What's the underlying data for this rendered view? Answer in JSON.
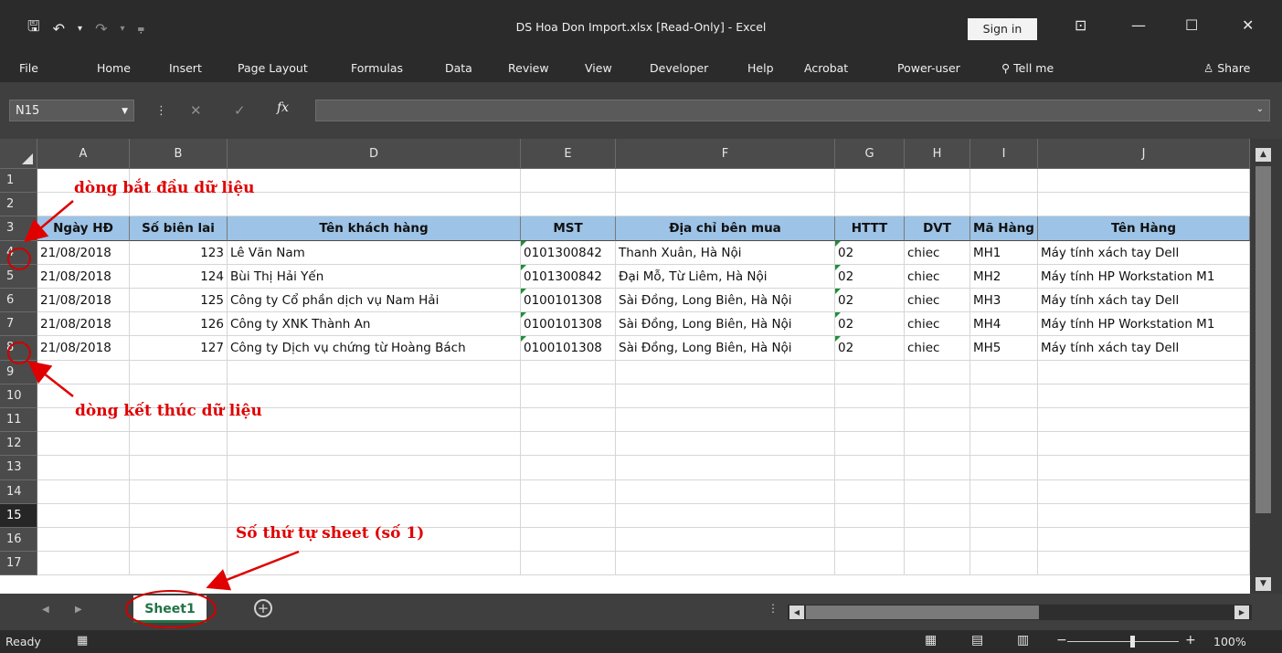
{
  "window": {
    "title": "DS Hoa Don Import.xlsx  [Read-Only]  -  Excel",
    "sign_in": "Sign in",
    "qat": {
      "save": "🖫",
      "undo": "↶",
      "undo_dd": "▾",
      "redo": "↷",
      "redo_dd": "▾",
      "customize": "⩦"
    },
    "controls": {
      "ribbon_display": "⊡",
      "minimize": "—",
      "maximize": "☐",
      "close": "✕"
    }
  },
  "menu": [
    "File",
    "Home",
    "Insert",
    "Page Layout",
    "Formulas",
    "Data",
    "Review",
    "View",
    "Developer",
    "Help",
    "Acrobat",
    "Power-user"
  ],
  "tell_me": "Tell me",
  "share": "Share",
  "formula_bar": {
    "name_box": "N15",
    "cancel": "✕",
    "enter": "✓",
    "fx": "fx",
    "value": ""
  },
  "columns": [
    "A",
    "B",
    "D",
    "E",
    "F",
    "G",
    "H",
    "I",
    "J"
  ],
  "row_numbers": [
    "1",
    "2",
    "3",
    "4",
    "5",
    "6",
    "7",
    "8",
    "9",
    "10",
    "11",
    "12",
    "13",
    "14",
    "15",
    "16",
    "17"
  ],
  "active_row": "15",
  "table": {
    "headers": [
      "Ngày HĐ",
      "Số biên lai",
      "Tên khách hàng",
      "MST",
      "Địa chỉ bên mua",
      "HTTT",
      "DVT",
      "Mã Hàng",
      "Tên Hàng"
    ],
    "rows": [
      [
        "21/08/2018",
        "123",
        "Lê Văn Nam",
        "0101300842",
        "Thanh Xuân, Hà Nội",
        "02",
        "chiec",
        "MH1",
        "Máy tính xách tay Dell"
      ],
      [
        "21/08/2018",
        "124",
        "Bùi Thị Hải Yến",
        "0101300842",
        "Đại Mỗ, Từ Liêm, Hà Nội",
        "02",
        "chiec",
        "MH2",
        "Máy tính HP Workstation M1"
      ],
      [
        "21/08/2018",
        "125",
        "Công ty Cổ phần dịch vụ Nam Hải",
        "0100101308",
        "Sài Đồng, Long Biên, Hà Nội",
        "02",
        "chiec",
        "MH3",
        "Máy tính xách tay Dell"
      ],
      [
        "21/08/2018",
        "126",
        "Công ty XNK Thành An",
        "0100101308",
        "Sài Đồng, Long Biên, Hà Nội",
        "02",
        "chiec",
        "MH4",
        "Máy tính HP Workstation M1"
      ],
      [
        "21/08/2018",
        "127",
        "Công ty Dịch vụ chứng từ Hoàng Bách",
        "0100101308",
        "Sài Đồng, Long Biên, Hà Nội",
        "02",
        "chiec",
        "MH5",
        "Máy tính xách tay Dell"
      ]
    ]
  },
  "annotations": {
    "start": "dòng bắt đầu dữ liệu",
    "end": "dòng kết thúc dữ liệu",
    "sheet": "Số thứ tự sheet (số 1)"
  },
  "sheet_tabs": [
    "Sheet1"
  ],
  "status": {
    "ready": "Ready",
    "zoom": "100%"
  },
  "colors": {
    "header_fill": "#9dc3e6",
    "accent": "#217346",
    "annotation": "#e00000"
  }
}
